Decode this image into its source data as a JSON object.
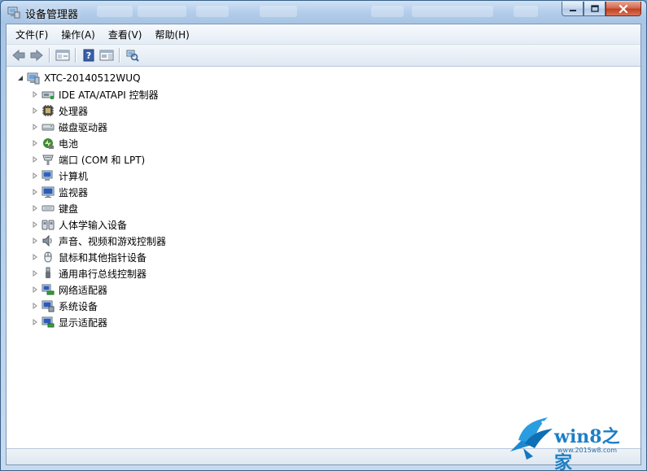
{
  "window": {
    "title": "设备管理器"
  },
  "menu": [
    "文件(F)",
    "操作(A)",
    "查看(V)",
    "帮助(H)"
  ],
  "toolbar": [
    {
      "name": "back-icon"
    },
    {
      "name": "forward-icon"
    },
    {
      "name": "sep"
    },
    {
      "name": "properties-pane-icon"
    },
    {
      "name": "sep"
    },
    {
      "name": "help-icon"
    },
    {
      "name": "console-tree-icon"
    },
    {
      "name": "sep"
    },
    {
      "name": "scan-hardware-icon"
    }
  ],
  "tree": {
    "root": "XTC-20140512WUQ",
    "items": [
      {
        "label": "IDE ATA/ATAPI 控制器",
        "icon": "ide-controller-icon"
      },
      {
        "label": "处理器",
        "icon": "processor-icon"
      },
      {
        "label": "磁盘驱动器",
        "icon": "disk-drive-icon"
      },
      {
        "label": "电池",
        "icon": "battery-icon"
      },
      {
        "label": "端口 (COM 和 LPT)",
        "icon": "port-icon"
      },
      {
        "label": "计算机",
        "icon": "computer-icon"
      },
      {
        "label": "监视器",
        "icon": "monitor-icon"
      },
      {
        "label": "键盘",
        "icon": "keyboard-icon"
      },
      {
        "label": "人体学输入设备",
        "icon": "hid-icon"
      },
      {
        "label": "声音、视频和游戏控制器",
        "icon": "sound-icon"
      },
      {
        "label": "鼠标和其他指针设备",
        "icon": "mouse-icon"
      },
      {
        "label": "通用串行总线控制器",
        "icon": "usb-icon"
      },
      {
        "label": "网络适配器",
        "icon": "network-adapter-icon"
      },
      {
        "label": "系统设备",
        "icon": "system-device-icon"
      },
      {
        "label": "显示适配器",
        "icon": "display-adapter-icon"
      }
    ]
  },
  "watermark": {
    "brand": "win8之家",
    "url": "www.2015w8.com"
  }
}
